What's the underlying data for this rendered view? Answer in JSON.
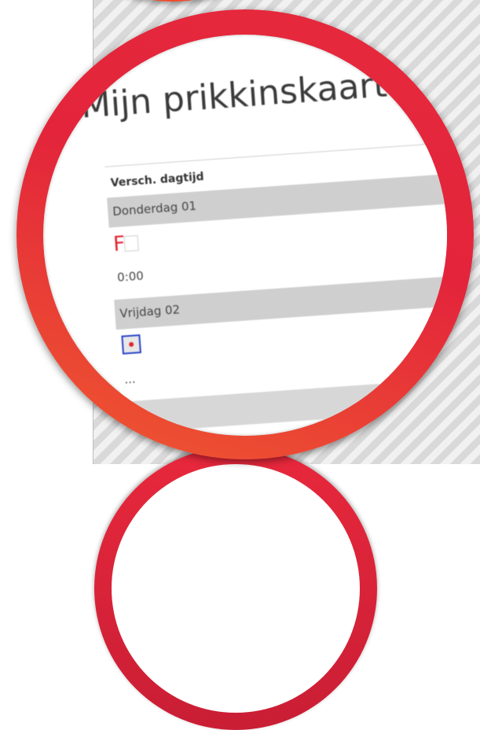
{
  "title": "Mijn prikkinskaart",
  "table": {
    "column_header": "Versch. dagtijd",
    "days": [
      {
        "label": "Donderdag 01",
        "code": "F",
        "time": "0:00"
      },
      {
        "label": "Vrijdag 02"
      }
    ],
    "partial_text": "..."
  },
  "colors": {
    "ring": "#e3243b",
    "ring_orange": "#ef5a2f",
    "code_red": "#e2232e",
    "mark_border": "#2a43c9",
    "day_row_bg": "#cfcfcf"
  },
  "icons": {
    "code_marker": "red-f-letter",
    "selected_marker": "blue-box-red-dot"
  }
}
